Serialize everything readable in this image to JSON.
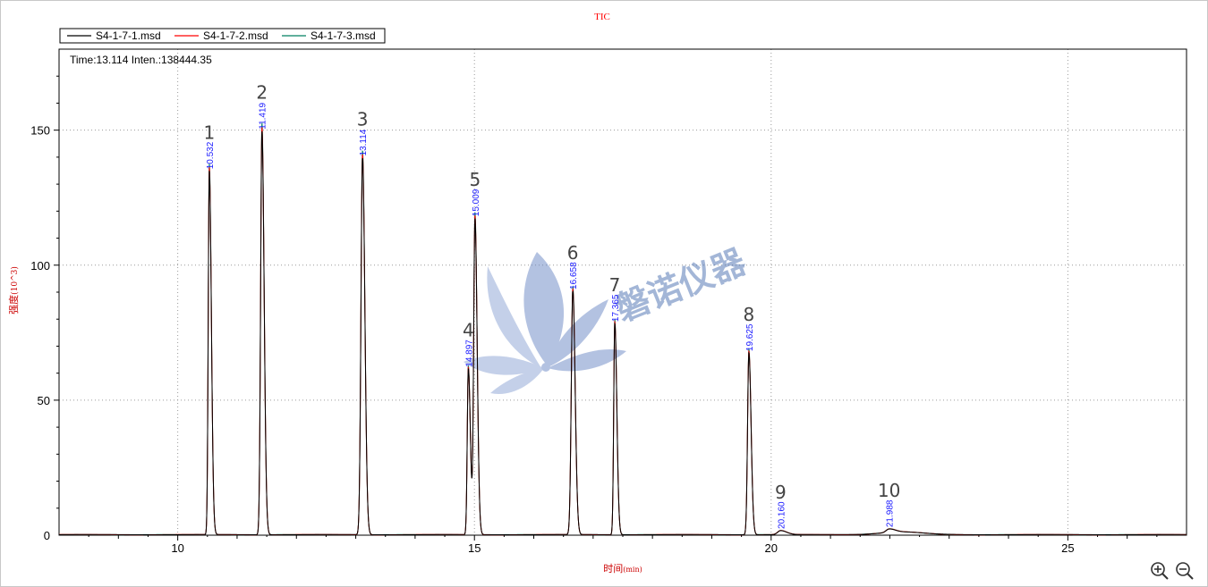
{
  "chart_data": {
    "type": "line",
    "title": "TIC",
    "xlabel": "时间",
    "xunit": "(min)",
    "ylabel": "强度",
    "yunit": "(10^3)",
    "xlim": [
      8,
      27
    ],
    "ylim": [
      0,
      180
    ],
    "xticks": [
      10,
      15,
      20,
      25
    ],
    "yticks": [
      0,
      50,
      100,
      150
    ],
    "grid": true,
    "legend_position": "top-left",
    "readout": "Time:13.114  Inten.:138444.35",
    "series": [
      {
        "name": "S4-1-7-1.msd",
        "color": "#000000"
      },
      {
        "name": "S4-1-7-2.msd",
        "color": "#ff0000"
      },
      {
        "name": "S4-1-7-3.msd",
        "color": "#008060"
      }
    ],
    "peaks": [
      {
        "label": "1",
        "rt": 10.532,
        "height": 136,
        "rt_text": "10.532"
      },
      {
        "label": "2",
        "rt": 11.419,
        "height": 151,
        "rt_text": "11.419"
      },
      {
        "label": "3",
        "rt": 13.114,
        "height": 141,
        "rt_text": "13.114"
      },
      {
        "label": "4",
        "rt": 14.897,
        "height": 62,
        "rt_text": "14.897"
      },
      {
        "label": "5",
        "rt": 15.009,
        "height": 118,
        "rt_text": "15.009"
      },
      {
        "label": "6",
        "rt": 16.658,
        "height": 91,
        "rt_text": "16.658"
      },
      {
        "label": "7",
        "rt": 17.365,
        "height": 79,
        "rt_text": "17.365"
      },
      {
        "label": "8",
        "rt": 19.625,
        "height": 68,
        "rt_text": "19.625"
      },
      {
        "label": "9",
        "rt": 20.16,
        "height": 1.5,
        "rt_text": "20.160"
      },
      {
        "label": "10",
        "rt": 21.988,
        "height": 1.3,
        "rt_text": "21.988"
      }
    ]
  },
  "watermark": {
    "text": "磐诺仪器",
    "color": "#4a6fb0"
  },
  "toolbar": {
    "zoom_in_icon": "zoom-in-icon",
    "zoom_out_icon": "zoom-out-icon"
  }
}
